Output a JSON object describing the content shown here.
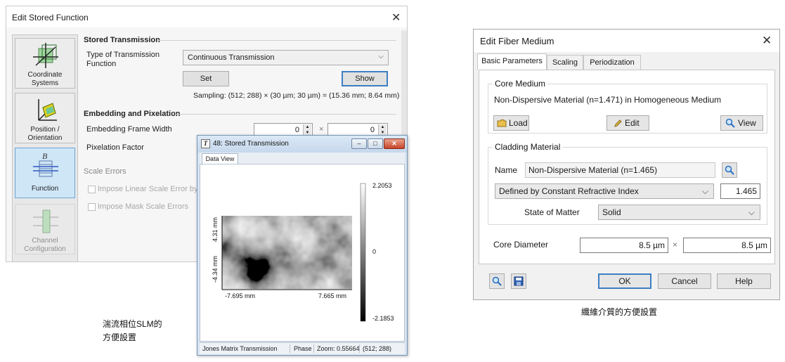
{
  "stored_function_dialog": {
    "title": "Edit Stored Function",
    "close_glyph": "✕",
    "rail": [
      {
        "label": "Coordinate Systems",
        "icon": "coordinate-systems-icon"
      },
      {
        "label": "Position / Orientation",
        "icon": "position-orientation-icon"
      },
      {
        "label": "Function",
        "icon": "function-icon",
        "glyph": "B"
      },
      {
        "label": "Channel Configuration",
        "icon": "channel-configuration-icon"
      }
    ],
    "stored_transmission": {
      "section_title": "Stored Transmission",
      "type_label": "Type of Transmission Function",
      "type_value": "Continuous Transmission",
      "set_label": "Set",
      "show_label": "Show",
      "sampling": "Sampling: (512; 288) × (30 µm; 30 µm) = (15.36 mm; 8.64 mm)"
    },
    "embedding": {
      "section_title": "Embedding and Pixelation",
      "frame_width_label": "Embedding Frame Width",
      "frame_width_x": "0",
      "frame_width_y": "0",
      "times": "×",
      "pixelation_label": "Pixelation Factor"
    },
    "scale_errors": {
      "section_title": "Scale Errors",
      "linear_label": "Impose Linear Scale Error by S",
      "mask_label": "Impose Mask Scale Errors"
    }
  },
  "stored_transmission_window": {
    "title": "48: Stored Transmission",
    "title_icon": "T",
    "tab": "Data View",
    "min_glyph": "‒",
    "max_glyph": "□",
    "close_glyph": "✕",
    "status": {
      "mode": "Jones Matrix Transmission",
      "quantity": "Phase",
      "zoom": "Zoom: 0.55664",
      "size": "(512; 288)"
    }
  },
  "chart_data": {
    "type": "heatmap",
    "title": "",
    "colormap": "grayscale",
    "x_tick_labels": [
      "-7.695 mm",
      "7.665 mm"
    ],
    "y_tick_labels": [
      "4.31 mm",
      "-4.34 mm"
    ],
    "colorbar_labels": [
      "2.2053",
      "0",
      "-2.1853"
    ],
    "value_range": [
      -2.1853,
      2.2053
    ],
    "grid": false
  },
  "fiber_medium_dialog": {
    "title": "Edit Fiber Medium",
    "close_glyph": "✕",
    "tabs": [
      "Basic Parameters",
      "Scaling",
      "Periodization"
    ],
    "core_medium": {
      "group_title": "Core Medium",
      "description": "Non-Dispersive Material (n=1.471) in Homogeneous Medium",
      "load_label": "Load",
      "edit_label": "Edit",
      "view_label": "View"
    },
    "cladding": {
      "group_title": "Cladding Material",
      "name_label": "Name",
      "name_value": "Non-Dispersive Material (n=1.465)",
      "definition_value": "Defined by Constant Refractive Index",
      "index_value": "1.465",
      "state_label": "State of Matter",
      "state_value": "Solid"
    },
    "core_diameter": {
      "label": "Core Diameter",
      "x_value": "8.5 µm",
      "times": "×",
      "y_value": "8.5 µm"
    },
    "footer": {
      "ok_label": "OK",
      "cancel_label": "Cancel",
      "help_label": "Help"
    }
  },
  "captions": {
    "left_line1": "湍流相位SLM的",
    "left_line2": "方便設置",
    "right": "纖維介質的方便設置"
  }
}
